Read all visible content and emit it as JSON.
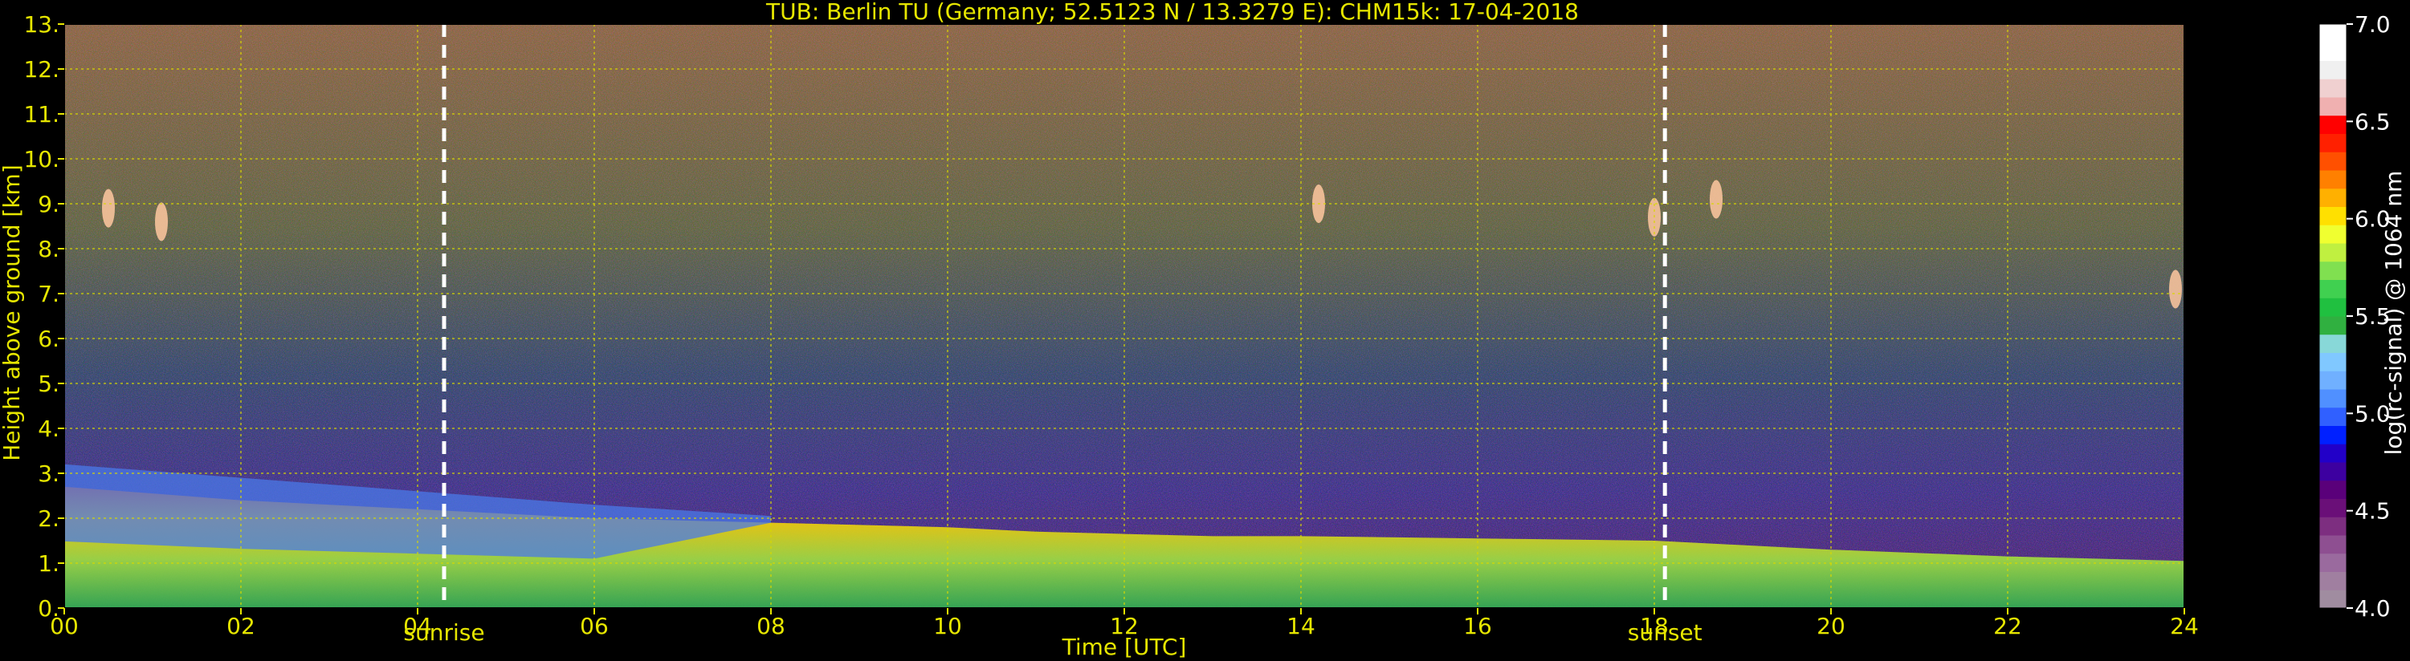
{
  "chart_data": {
    "type": "heatmap",
    "title": "TUB: Berlin TU (Germany; 52.5123 N / 13.3279 E):    CHM15k: 17-04-2018",
    "xlabel": "Time [UTC]",
    "ylabel": "Height above ground [km]",
    "xlim": [
      0,
      24
    ],
    "ylim": [
      0,
      13
    ],
    "x_ticks": [
      "00",
      "02",
      "04",
      "06",
      "08",
      "10",
      "12",
      "14",
      "16",
      "18",
      "20",
      "22",
      "24"
    ],
    "y_ticks": [
      "0.",
      "1.",
      "2.",
      "3.",
      "4.",
      "5.",
      "6.",
      "7.",
      "8.",
      "9.",
      "10.",
      "11.",
      "12.",
      "13."
    ],
    "grid": true,
    "events": [
      {
        "label": "sunrise",
        "time": 4.3
      },
      {
        "label": "sunset",
        "time": 18.12
      }
    ],
    "colorbar": {
      "label": "log(rc-signal) @ 1064 nm",
      "range": [
        4.0,
        7.0
      ],
      "ticks": [
        "4.0",
        "4.5",
        "5.0",
        "5.5",
        "6.0",
        "6.5",
        "7.0"
      ],
      "colors": [
        "#a08ca0",
        "#a07fa0",
        "#9a6a9e",
        "#8e4f91",
        "#7d2e80",
        "#6a0f78",
        "#5a007a",
        "#3d00a0",
        "#2200c8",
        "#0020ff",
        "#3060ff",
        "#5090ff",
        "#70b0ff",
        "#80c8ff",
        "#88d8d8",
        "#30b040",
        "#20c040",
        "#40d050",
        "#80e050",
        "#c0f040",
        "#f0ff30",
        "#ffe000",
        "#ffb000",
        "#ff8000",
        "#ff5000",
        "#ff2000",
        "#ff0000",
        "#f0b0b0",
        "#f0d0d0",
        "#f0f0f0",
        "#ffffff",
        "#ffffff"
      ]
    },
    "boundary_layer_top_km": {
      "time": [
        0,
        2,
        4,
        6,
        8,
        10,
        11,
        12,
        13,
        14,
        16,
        18,
        20,
        22,
        24
      ],
      "height": [
        2.7,
        2.4,
        2.2,
        2.0,
        1.9,
        1.8,
        1.7,
        1.65,
        1.6,
        1.6,
        1.55,
        1.5,
        1.3,
        1.15,
        1.05
      ]
    },
    "cirrus_patches": [
      {
        "time": 0.5,
        "height": 8.9
      },
      {
        "time": 1.1,
        "height": 8.6
      },
      {
        "time": 14.2,
        "height": 9.0
      },
      {
        "time": 18.0,
        "height": 8.7
      },
      {
        "time": 18.7,
        "height": 9.1
      },
      {
        "time": 23.9,
        "height": 7.1
      }
    ]
  }
}
